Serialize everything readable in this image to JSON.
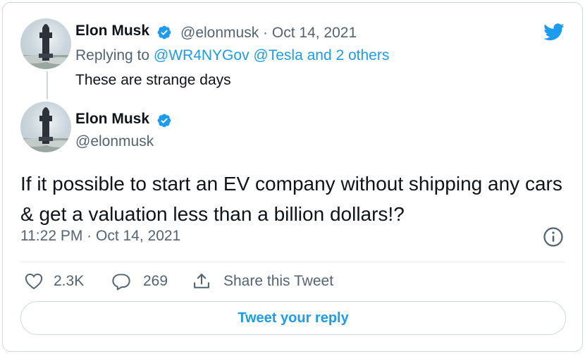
{
  "parent_tweet": {
    "author_name": "Elon Musk",
    "author_handle": "@elonmusk",
    "separator": "·",
    "date": "Oct 14, 2021",
    "replying_prefix": "Replying to ",
    "replying_mentions": "@WR4NYGov @Tesla",
    "replying_suffix": " and 2 others",
    "text": "These are strange days"
  },
  "main_tweet": {
    "author_name": "Elon Musk",
    "author_handle": "@elonmusk",
    "text": "If it possible to start an EV company without shipping any cars & get a valuation less than a billion dollars!?",
    "timestamp": "11:22 PM · Oct 14, 2021"
  },
  "actions": {
    "likes": "2.3K",
    "replies": "269",
    "share_label": "Share this Tweet"
  },
  "reply_button_label": "Tweet your reply",
  "colors": {
    "accent": "#1d9bf0",
    "text": "#0f1419",
    "muted": "#536471",
    "border": "#cfd9de"
  },
  "icons": [
    "twitter-bird-icon",
    "verified-badge-icon",
    "info-icon",
    "heart-icon",
    "reply-icon",
    "share-icon"
  ]
}
